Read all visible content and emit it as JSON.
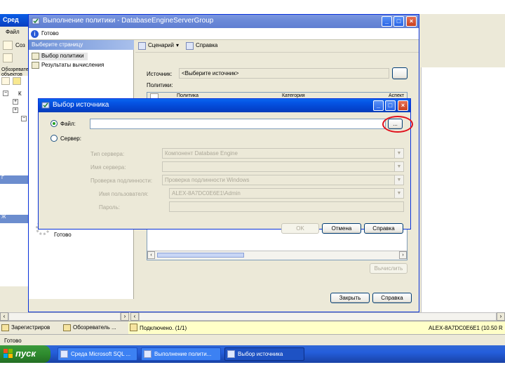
{
  "background": {
    "ssms_title": "Сред",
    "menu_file": "Файл",
    "toolbar_item": "Соз",
    "object_explorer_title": "Обозреватель объектов",
    "section1": "Г",
    "section2": "Ж",
    "tree_nodes": [
      "К",
      "",
      ""
    ]
  },
  "policy_window": {
    "title": "Выполнение политики - DatabaseEngineServerGroup",
    "status_ready": "Готово",
    "left_header": "Выберите страницу",
    "pages": [
      "Выбор политики",
      "Результаты вычисления"
    ],
    "left_status": "Готово",
    "toolbar_script": "Сценарий",
    "toolbar_dropdown": "▾",
    "toolbar_help": "Справка",
    "source_label": "Источник:",
    "source_value": "<Выберите источник>",
    "source_browse": "",
    "policies_label": "Политики:",
    "columns": [
      "",
      "Политика",
      "Категория",
      "Аспект"
    ],
    "evaluate_button": "Вычислить",
    "close_button": "Закрыть",
    "help_button": "Справка"
  },
  "source_dialog": {
    "title": "Выбор источника",
    "file_label": "Файл:",
    "file_value": "",
    "browse_button": "...",
    "server_label": "Сервер:",
    "server_type_label": "Тип сервера:",
    "server_type_value": "Компонент Database Engine",
    "server_name_label": "Имя сервера:",
    "server_name_value": "",
    "auth_label": "Проверка подлинности:",
    "auth_value": "Проверка подлинности Windows",
    "username_label": "Имя пользователя:",
    "username_value": "ALEX-8A7DC0E6E1\\Admin",
    "password_label": "Пароль:",
    "password_value": "",
    "ok_button": "OK",
    "cancel_button": "Отмена",
    "help_button": "Справка",
    "file_selected": true
  },
  "bottom": {
    "tabs": [
      "Зарегистриров",
      "Обозреватель ..."
    ],
    "connected": "Подключено. (1/1)",
    "server_info": "ALEX-8A7DC0E6E1 (10.50 R",
    "status": "Готово"
  },
  "taskbar": {
    "start": "пуск",
    "tasks": [
      "Среда Microsoft SQL ...",
      "Выполнение полити...",
      "Выбор источника"
    ]
  },
  "colors": {
    "title_active": "#0553e3",
    "annotation_ring": "#e0101c"
  }
}
